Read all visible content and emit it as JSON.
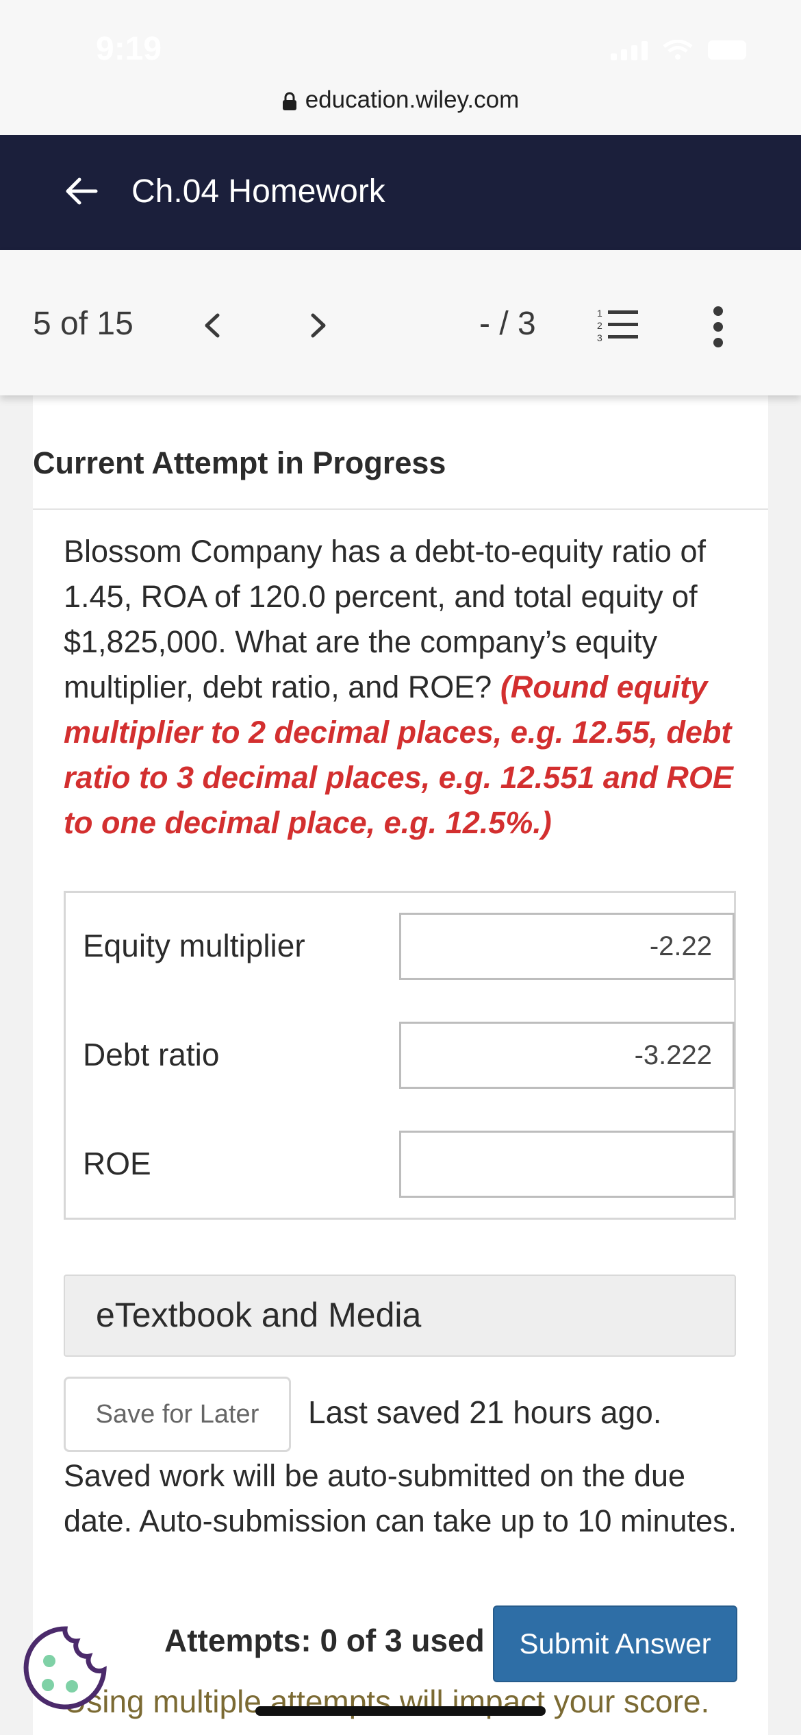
{
  "status_bar": {
    "time": "9:19"
  },
  "browser": {
    "url": "education.wiley.com"
  },
  "header": {
    "title": "Ch.04 Homework"
  },
  "nav": {
    "position": "5 of 15",
    "score": "- / 3"
  },
  "main": {
    "attempt_heading": "Current Attempt in Progress",
    "question_text": "Blossom Company has a debt-to-equity ratio of 1.45, ROA of 120.0 percent, and total equity of $1,825,000. What are the company’s equity multiplier, debt ratio, and ROE?",
    "instructions": "(Round equity multiplier to 2 decimal places, e.g. 12.55, debt ratio to 3 decimal places, e.g. 12.551 and ROE to one decimal place, e.g. 12.5%.)",
    "answers": [
      {
        "label": "Equity multiplier",
        "value": "-2.22"
      },
      {
        "label": "Debt ratio",
        "value": "-3.222"
      },
      {
        "label": "ROE",
        "value": ""
      }
    ],
    "etextbook_label": "eTextbook and Media",
    "save_label": "Save for Later",
    "last_saved": "Last saved 21 hours ago.",
    "auto_submit_note": "Saved work will be auto-submitted on the due date. Auto-submission can take up to 10 minutes.",
    "attempts_used": "Attempts: 0 of 3 used",
    "submit_label": "Submit Answer",
    "score_warning": "Using multiple attempts will impact your score."
  },
  "colors": {
    "header_bg": "#1b1f3b",
    "instruction_red": "#d32f2f",
    "submit_blue": "#2e6ea6"
  },
  "icons": [
    "lock-icon",
    "back-arrow-icon",
    "chevron-left-icon",
    "chevron-right-icon",
    "numbered-list-icon",
    "more-vertical-icon",
    "cookie-icon"
  ]
}
